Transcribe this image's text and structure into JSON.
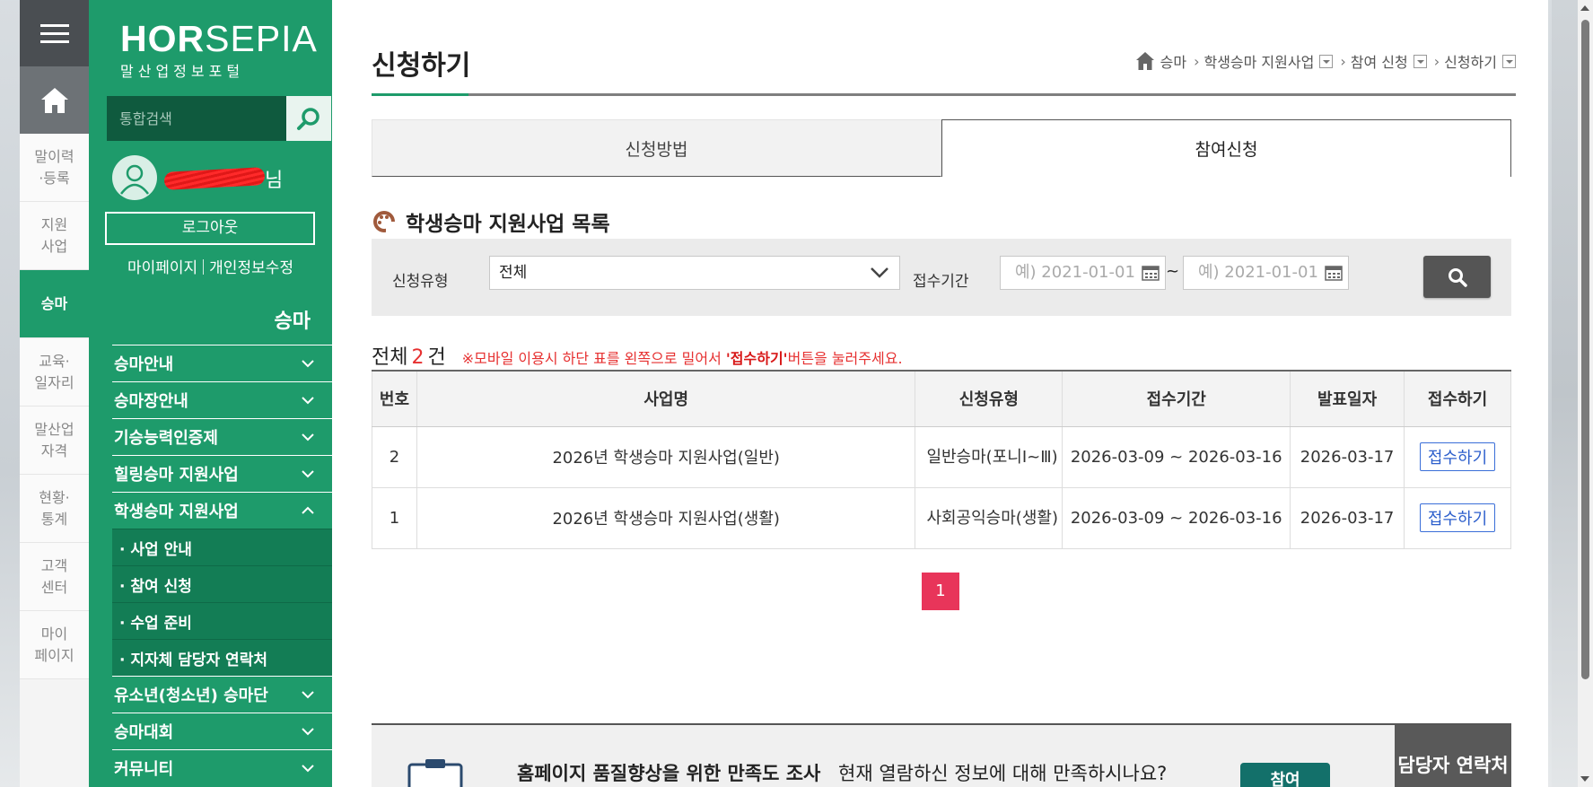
{
  "strip": {
    "items": [
      {
        "label": "말이력\n·등록"
      },
      {
        "label": "지원\n사업"
      },
      {
        "label": "승마"
      },
      {
        "label": "교육·\n일자리"
      },
      {
        "label": "말산업\n자격"
      },
      {
        "label": "현황·\n통계"
      },
      {
        "label": "고객\n센터"
      },
      {
        "label": "마이\n페이지"
      }
    ]
  },
  "sidebar": {
    "logo": {
      "part1": "HOR",
      "part2": "SE",
      "part3": "PIA",
      "sub": "말산업정보포털"
    },
    "search_placeholder": "통합검색",
    "user_suffix": "님",
    "logout": "로그아웃",
    "mypage": "마이페이지",
    "edit_info": "개인정보수정",
    "title": "승마",
    "menu": [
      {
        "label": "승마안내"
      },
      {
        "label": "승마장안내"
      },
      {
        "label": "기승능력인증제"
      },
      {
        "label": "힐링승마 지원사업"
      },
      {
        "label": "학생승마 지원사업"
      },
      {
        "label": "유소년(청소년) 승마단"
      },
      {
        "label": "승마대회"
      },
      {
        "label": "커뮤니티"
      }
    ],
    "submenu": [
      {
        "label": "· 사업 안내"
      },
      {
        "label": "· 참여 신청"
      },
      {
        "label": "· 수업 준비"
      },
      {
        "label": "· 지자체 담당자 연락처"
      }
    ]
  },
  "header": {
    "title": "신청하기",
    "breadcrumb": [
      "승마",
      "학생승마 지원사업",
      "참여 신청",
      "신청하기"
    ]
  },
  "tabs": [
    {
      "label": "신청방법"
    },
    {
      "label": "참여신청"
    }
  ],
  "section_title": "학생승마 지원사업 목록",
  "filter": {
    "type_label": "신청유형",
    "type_value": "전체",
    "period_label": "접수기간",
    "date_placeholder": "예) 2021-01-01",
    "tilde": "~"
  },
  "count": {
    "prefix": "전체",
    "value": "2",
    "suffix": "건",
    "note_a": "※모바일 이용시 하단 표를 왼쪽으로 밀어서 ",
    "note_b": "'접수하기'",
    "note_c": "버튼을 눌러주세요."
  },
  "table": {
    "headers": [
      "번호",
      "사업명",
      "신청유형",
      "접수기간",
      "발표일자",
      "접수하기"
    ],
    "rows": [
      {
        "no": "2",
        "name": "2026년 학생승마 지원사업(일반)",
        "type": "일반승마(포니Ⅰ~Ⅲ)",
        "period": "2026-03-09 ~ 2026-03-16",
        "date": "2026-03-17",
        "action": "접수하기"
      },
      {
        "no": "1",
        "name": "2026년 학생승마 지원사업(생활)",
        "type": "사회공익승마(생활)",
        "period": "2026-03-09 ~ 2026-03-16",
        "date": "2026-03-17",
        "action": "접수하기"
      }
    ]
  },
  "pager": {
    "current": "1"
  },
  "survey": {
    "title": "홈페이지 품질향상을 위한 만족도 조사",
    "question": "현재 열람하신 정보에 대해 만족하시나요?",
    "button": "참여",
    "contact": "담당자 연락처"
  },
  "colors": {
    "brand_green": "#1e9b6b",
    "accent_red": "#e8355a"
  }
}
